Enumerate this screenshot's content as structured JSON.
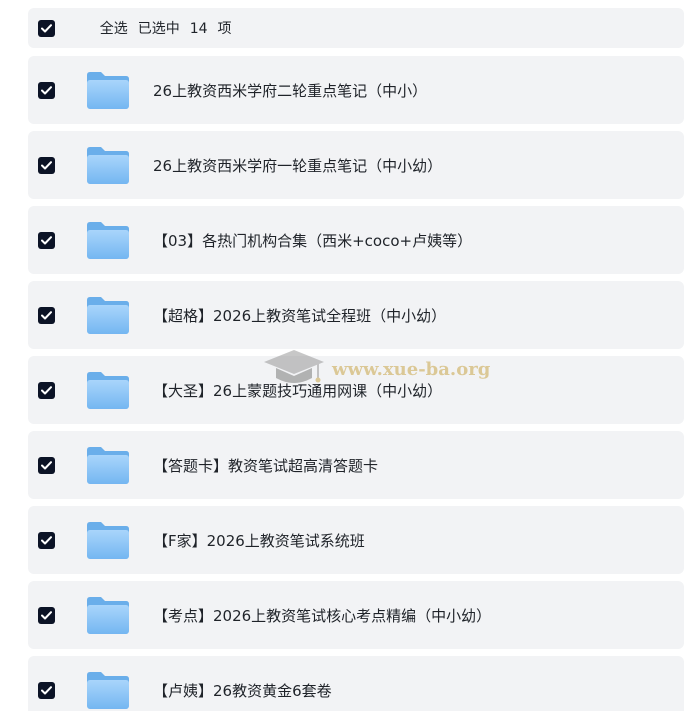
{
  "header": {
    "select_all_label": "全选",
    "selected_prefix": "已选中",
    "selected_count": "14",
    "selected_suffix": "项"
  },
  "items": [
    {
      "name": "26上教资西米学府二轮重点笔记（中小）",
      "checked": true,
      "icon": "folder-icon"
    },
    {
      "name": "26上教资西米学府一轮重点笔记（中小幼）",
      "checked": true,
      "icon": "folder-icon"
    },
    {
      "name": "【03】各热门机构合集（西米+coco+卢姨等）",
      "checked": true,
      "icon": "folder-icon"
    },
    {
      "name": "【超格】2026上教资笔试全程班（中小幼）",
      "checked": true,
      "icon": "folder-icon"
    },
    {
      "name": "【大圣】26上蒙题技巧通用网课（中小幼）",
      "checked": true,
      "icon": "folder-icon"
    },
    {
      "name": "【答题卡】教资笔试超高清答题卡",
      "checked": true,
      "icon": "folder-icon"
    },
    {
      "name": "【F家】2026上教资笔试系统班",
      "checked": true,
      "icon": "folder-icon"
    },
    {
      "name": "【考点】2026上教资笔试核心考点精编（中小幼）",
      "checked": true,
      "icon": "folder-icon"
    },
    {
      "name": "【卢姨】26教资黄金6套卷",
      "checked": true,
      "icon": "folder-icon"
    }
  ],
  "watermark": {
    "text": "www.xue-ba.org"
  },
  "colors": {
    "row_background": "#f2f3f5",
    "checkbox_fill": "#0c1326",
    "folder_blue": "#8cc4f5",
    "text": "#1f2329"
  }
}
